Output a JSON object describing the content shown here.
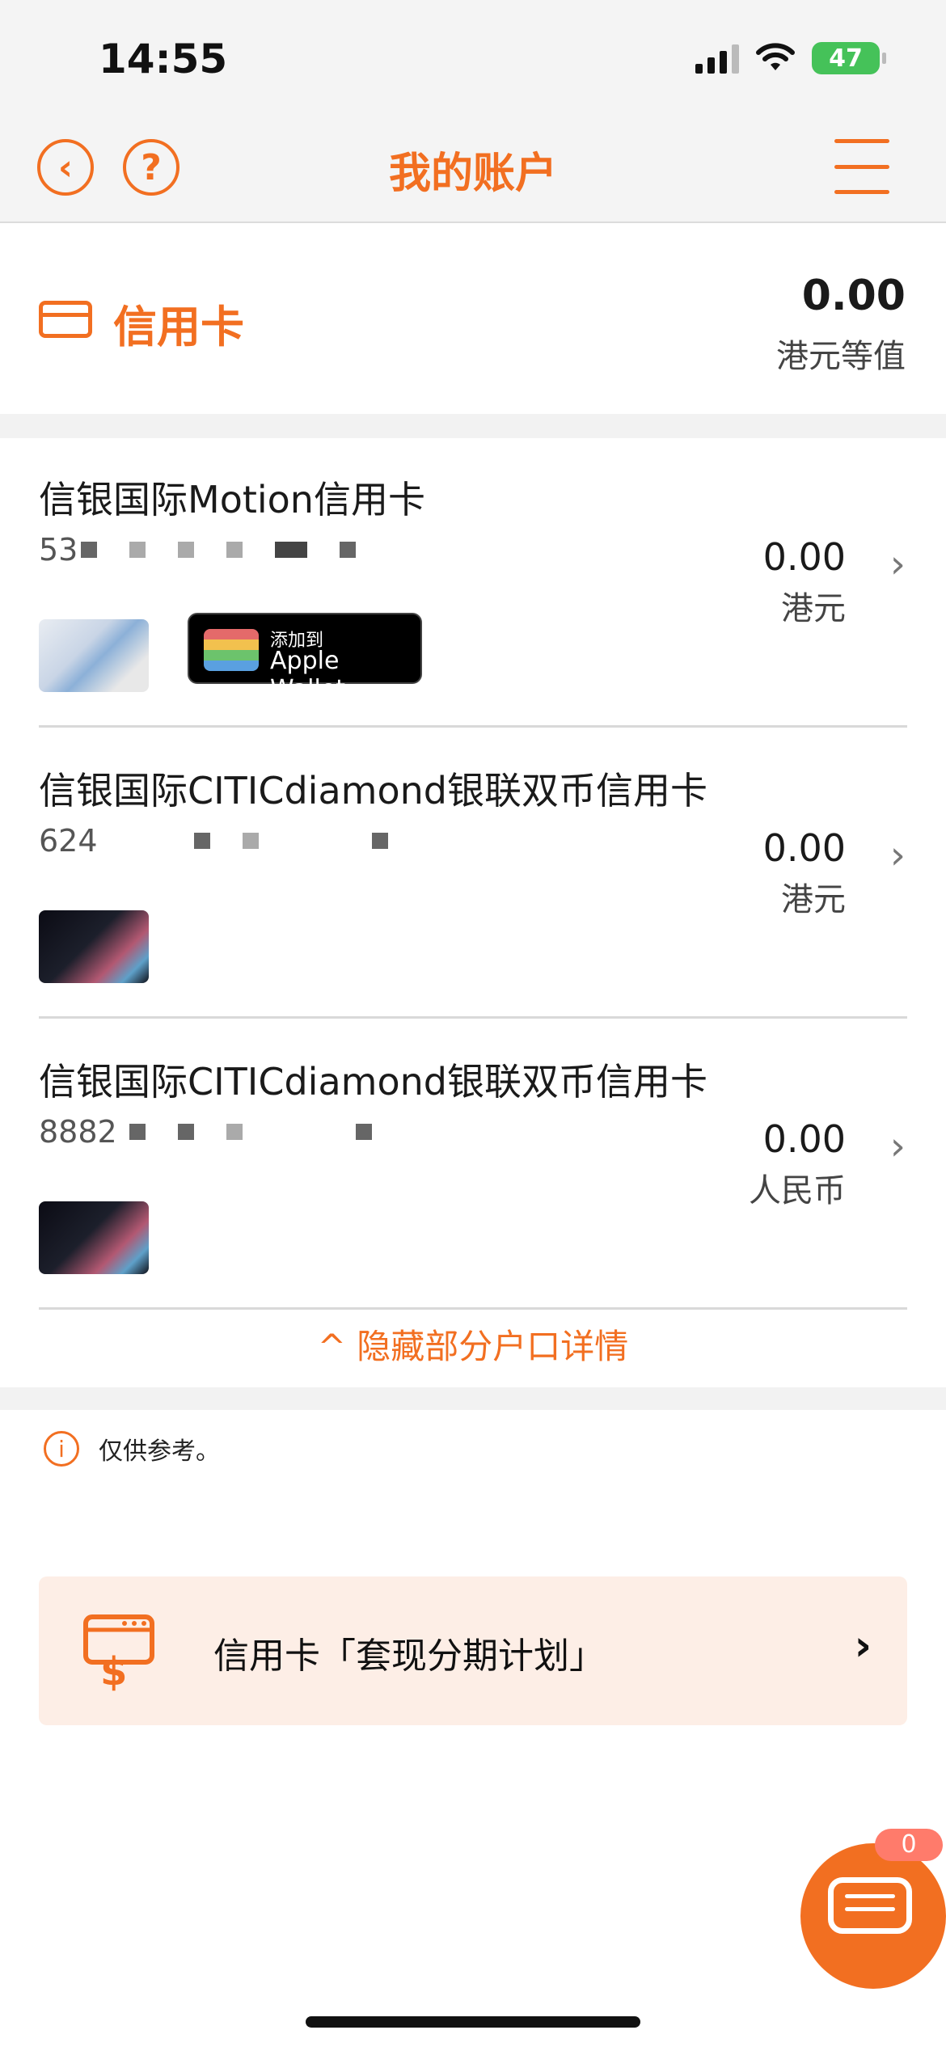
{
  "status_bar": {
    "time": "14:55",
    "battery": "47"
  },
  "header": {
    "title": "我的账户",
    "help_glyph": "?",
    "back_glyph": "‹"
  },
  "summary": {
    "label": "信用卡",
    "amount": "0.00",
    "unit": "港元等值"
  },
  "cards": [
    {
      "name": "信银国际Motion信用卡",
      "number_prefix": "53",
      "amount": "0.00",
      "unit": "港元",
      "thumb": "light",
      "wallet": true
    },
    {
      "name": "信银国际CITICdiamond银联双币信用卡",
      "number_prefix": "624",
      "amount": "0.00",
      "unit": "港元",
      "thumb": "dark",
      "wallet": false
    },
    {
      "name": "信银国际CITICdiamond银联双币信用卡",
      "number_prefix": "8882",
      "amount": "0.00",
      "unit": "人民币",
      "thumb": "dark",
      "wallet": false
    }
  ],
  "wallet_button": {
    "small": "添加到",
    "big": "Apple Wallet"
  },
  "hide_toggle": {
    "label": "隐藏部分户口详情"
  },
  "note": {
    "text": "仅供参考。",
    "icon_glyph": "i"
  },
  "promo": {
    "label": "信用卡「套现分期计划」"
  },
  "chat": {
    "badge": "0"
  },
  "colors": {
    "accent": "#f26f21",
    "promo_bg": "#fdeee6"
  }
}
